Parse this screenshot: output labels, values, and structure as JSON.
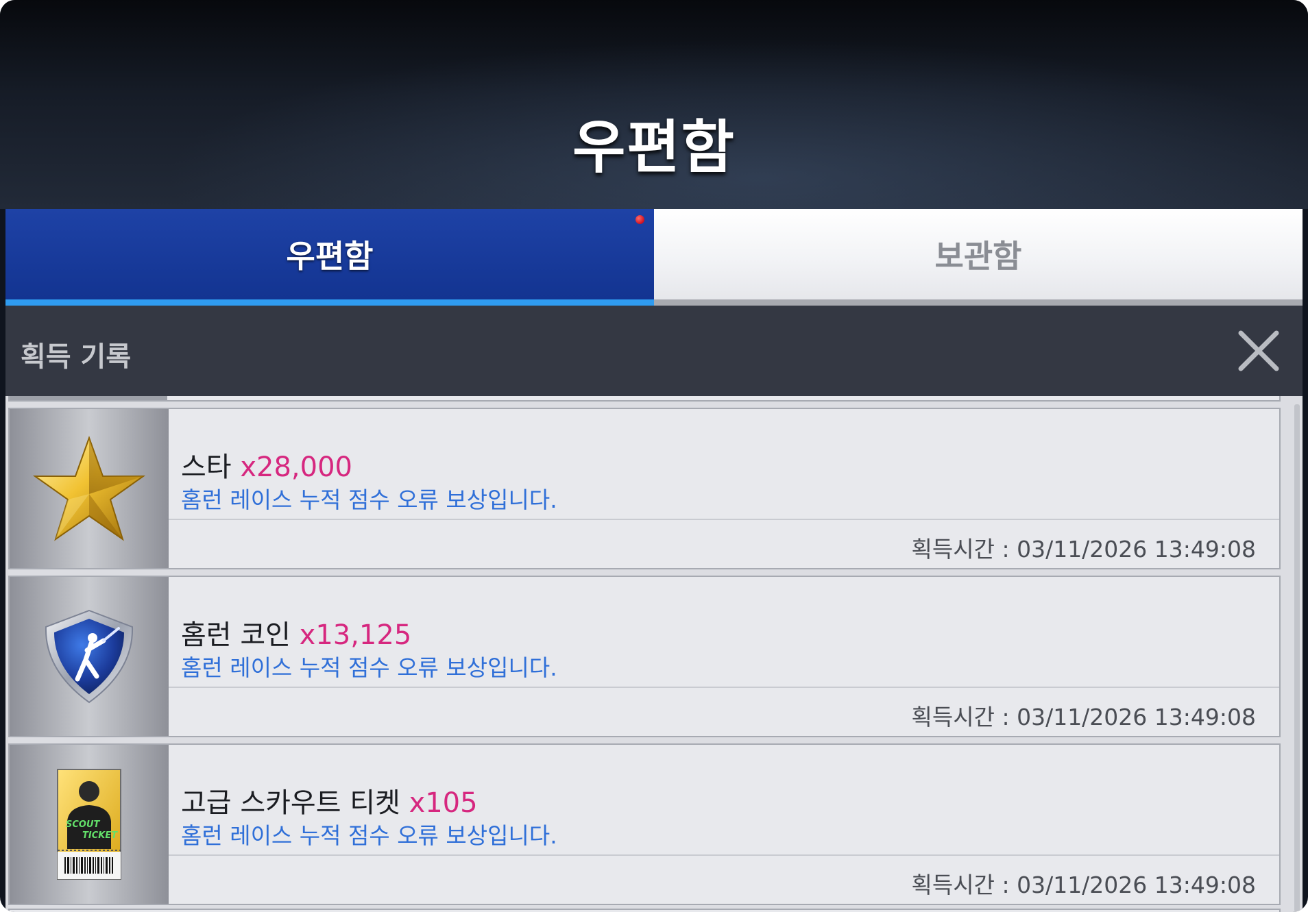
{
  "header": {
    "title": "우편함"
  },
  "tabs": [
    {
      "label": "우편함",
      "active": true,
      "has_notification": true
    },
    {
      "label": "보관함",
      "active": false
    }
  ],
  "subheader": {
    "title": "획득 기록",
    "close_icon": "close-icon"
  },
  "colors": {
    "active_tab": "#133491",
    "active_tab_underline": "#2f9bf0",
    "quantity_text": "#d6277f",
    "description_text": "#2f6fd8",
    "notification_dot": "#d01020"
  },
  "mail_items": [
    {
      "icon": "gold-star-icon",
      "name": "스타",
      "quantity": "x28,000",
      "description": "홈런 레이스 누적 점수 오류 보상입니다.",
      "acquired_time": "획득시간 : 03/11/2026 13:49:08"
    },
    {
      "icon": "homerun-coin-shield-icon",
      "name": "홈런 코인",
      "quantity": "x13,125",
      "description": "홈런 레이스 누적 점수 오류 보상입니다.",
      "acquired_time": "획득시간 : 03/11/2026 13:49:08"
    },
    {
      "icon": "scout-ticket-icon",
      "name": "고급 스카우트 티켓",
      "quantity": "x105",
      "description": "홈런 레이스 누적 점수 오류 보상입니다.",
      "acquired_time": "획득시간 : 03/11/2026 13:49:08",
      "ticket_text": [
        "SCOUT",
        "TICKET"
      ]
    }
  ]
}
